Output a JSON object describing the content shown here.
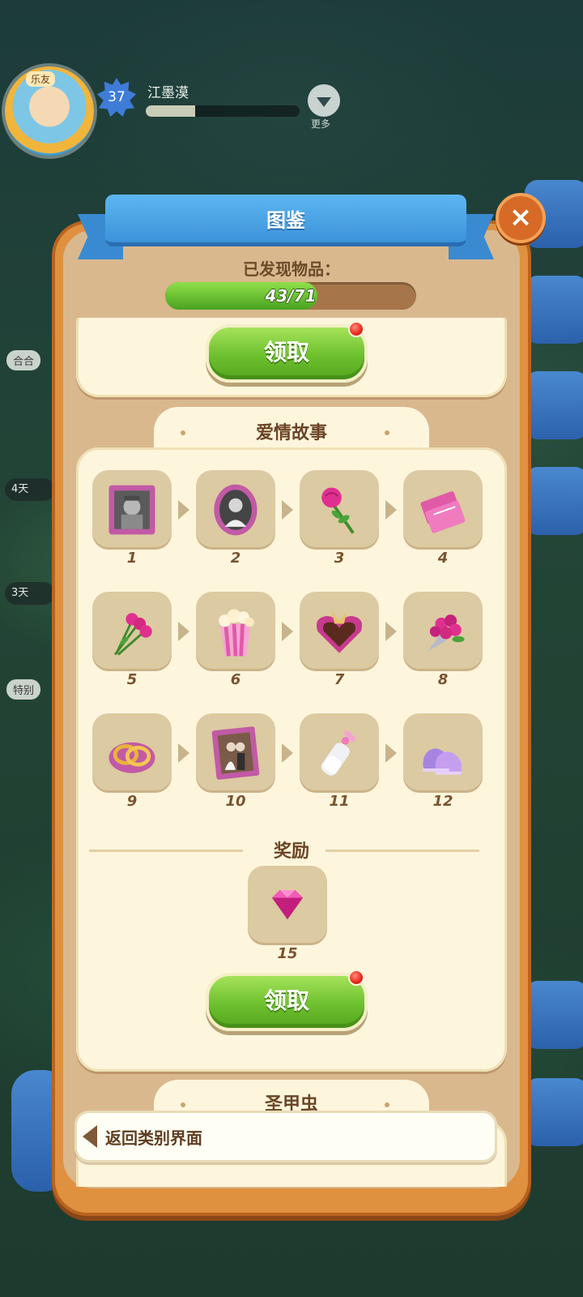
{
  "hud": {
    "avatar_tag": "乐友",
    "level": "37",
    "player_name": "江墨漠",
    "xp_fraction": 0.32,
    "more_label": "更多",
    "left_chips": [
      "合合",
      "特别"
    ],
    "timers": [
      "4天",
      "3天"
    ]
  },
  "dialog": {
    "title": "图鉴",
    "close_glyph": "×",
    "found_label": "已发现物品：",
    "progress": {
      "current": 43,
      "total": 71,
      "text": "43/71"
    }
  },
  "top_claim": {
    "label": "领取",
    "has_notification": true
  },
  "collection": {
    "title": "爱情故事",
    "items": [
      {
        "num": "1",
        "icon": "soldier-portrait-icon"
      },
      {
        "num": "2",
        "icon": "oval-bride-portrait-icon"
      },
      {
        "num": "3",
        "icon": "rose-icon"
      },
      {
        "num": "4",
        "icon": "cinema-tickets-icon"
      },
      {
        "num": "5",
        "icon": "rose-bunch-icon"
      },
      {
        "num": "6",
        "icon": "popcorn-icon"
      },
      {
        "num": "7",
        "icon": "heart-chocolate-box-icon"
      },
      {
        "num": "8",
        "icon": "flower-bouquet-icon"
      },
      {
        "num": "9",
        "icon": "wedding-rings-icon"
      },
      {
        "num": "10",
        "icon": "wedding-photo-icon"
      },
      {
        "num": "11",
        "icon": "baby-bottle-icon"
      },
      {
        "num": "12",
        "icon": "baby-shoes-icon"
      }
    ],
    "reward_label": "奖励",
    "reward": {
      "icon": "gem-icon",
      "amount": "15"
    },
    "claim_label": "领取",
    "claim_has_notification": true
  },
  "next_collection": {
    "title": "圣甲虫"
  },
  "back": {
    "label": "返回类别界面"
  },
  "colors": {
    "panel_orange": "#e0913f",
    "ribbon_blue": "#3c92d8",
    "button_green": "#6dc02e",
    "card_cream": "#fdf6dd"
  }
}
